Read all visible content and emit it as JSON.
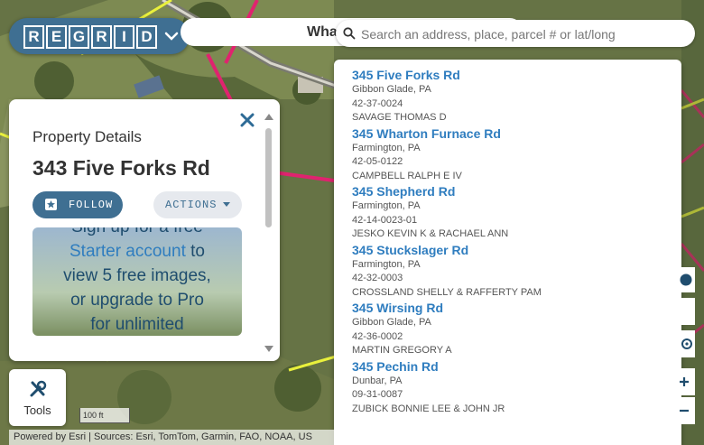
{
  "brand": {
    "name": "REGRID",
    "letters": [
      "R",
      "E",
      "G",
      "R",
      "I",
      "D"
    ]
  },
  "header": {
    "whats_new": "What's"
  },
  "search": {
    "placeholder": "Search an address, place, parcel # or lat/long"
  },
  "results": [
    {
      "address": "345 Five Forks Rd",
      "place": "Gibbon Glade, PA",
      "parcel": "42-37-0024",
      "owner": "SAVAGE THOMAS D"
    },
    {
      "address": "345 Wharton Furnace Rd",
      "place": "Farmington, PA",
      "parcel": "42-05-0122",
      "owner": "CAMPBELL RALPH E IV"
    },
    {
      "address": "345 Shepherd Rd",
      "place": "Farmington, PA",
      "parcel": "42-14-0023-01",
      "owner": "JESKO KEVIN K & RACHAEL ANN"
    },
    {
      "address": "345 Stuckslager Rd",
      "place": "Farmington, PA",
      "parcel": "42-32-0003",
      "owner": "CROSSLAND SHELLY & RAFFERTY PAM"
    },
    {
      "address": "345 Wirsing Rd",
      "place": "Gibbon Glade, PA",
      "parcel": "42-36-0002",
      "owner": "MARTIN GREGORY A"
    },
    {
      "address": "345 Pechin Rd",
      "place": "Dunbar, PA",
      "parcel": "09-31-0087",
      "owner": "ZUBICK BONNIE LEE & JOHN JR"
    }
  ],
  "property_panel": {
    "label": "Property Details",
    "title": "343 Five Forks Rd",
    "follow_label": "FOLLOW",
    "actions_label": "ACTIONS",
    "promo": {
      "line1": "Sign up for a free",
      "link": "Starter account",
      "line2": "to",
      "line3": "view 5 free images,",
      "line4": "or upgrade to Pro",
      "line5": "for unlimited"
    }
  },
  "tools": {
    "label": "Tools"
  },
  "scale": {
    "label": "100 ft"
  },
  "attribution": {
    "text": "Powered by Esri | Sources: Esri, TomTom, Garmin, FAO, NOAA, US"
  },
  "colors": {
    "brand_blue": "#3f6f92",
    "link_blue": "#2f7dbf",
    "parcel_pink": "#e0236f",
    "parcel_yellow": "#e9f03c"
  },
  "icons": [
    "chevron-down-icon",
    "search-icon",
    "close-icon",
    "star-icon",
    "caret-down-icon",
    "tools-icon",
    "help-icon",
    "target-icon",
    "zoom-in-icon",
    "zoom-out-icon"
  ]
}
